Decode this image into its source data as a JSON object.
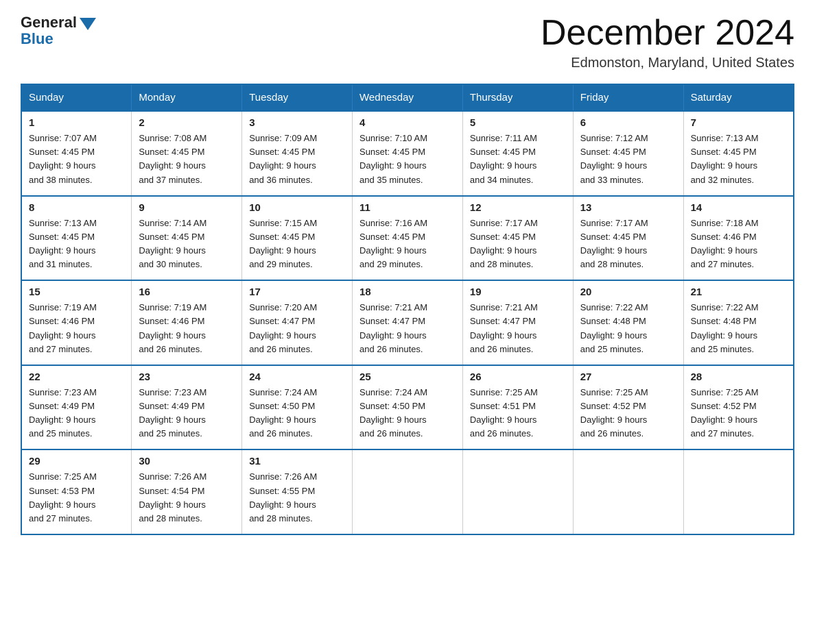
{
  "logo": {
    "general": "General",
    "blue": "Blue"
  },
  "title": "December 2024",
  "location": "Edmonston, Maryland, United States",
  "days_of_week": [
    "Sunday",
    "Monday",
    "Tuesday",
    "Wednesday",
    "Thursday",
    "Friday",
    "Saturday"
  ],
  "weeks": [
    [
      {
        "day": "1",
        "sunrise": "7:07 AM",
        "sunset": "4:45 PM",
        "daylight": "9 hours and 38 minutes."
      },
      {
        "day": "2",
        "sunrise": "7:08 AM",
        "sunset": "4:45 PM",
        "daylight": "9 hours and 37 minutes."
      },
      {
        "day": "3",
        "sunrise": "7:09 AM",
        "sunset": "4:45 PM",
        "daylight": "9 hours and 36 minutes."
      },
      {
        "day": "4",
        "sunrise": "7:10 AM",
        "sunset": "4:45 PM",
        "daylight": "9 hours and 35 minutes."
      },
      {
        "day": "5",
        "sunrise": "7:11 AM",
        "sunset": "4:45 PM",
        "daylight": "9 hours and 34 minutes."
      },
      {
        "day": "6",
        "sunrise": "7:12 AM",
        "sunset": "4:45 PM",
        "daylight": "9 hours and 33 minutes."
      },
      {
        "day": "7",
        "sunrise": "7:13 AM",
        "sunset": "4:45 PM",
        "daylight": "9 hours and 32 minutes."
      }
    ],
    [
      {
        "day": "8",
        "sunrise": "7:13 AM",
        "sunset": "4:45 PM",
        "daylight": "9 hours and 31 minutes."
      },
      {
        "day": "9",
        "sunrise": "7:14 AM",
        "sunset": "4:45 PM",
        "daylight": "9 hours and 30 minutes."
      },
      {
        "day": "10",
        "sunrise": "7:15 AM",
        "sunset": "4:45 PM",
        "daylight": "9 hours and 29 minutes."
      },
      {
        "day": "11",
        "sunrise": "7:16 AM",
        "sunset": "4:45 PM",
        "daylight": "9 hours and 29 minutes."
      },
      {
        "day": "12",
        "sunrise": "7:17 AM",
        "sunset": "4:45 PM",
        "daylight": "9 hours and 28 minutes."
      },
      {
        "day": "13",
        "sunrise": "7:17 AM",
        "sunset": "4:45 PM",
        "daylight": "9 hours and 28 minutes."
      },
      {
        "day": "14",
        "sunrise": "7:18 AM",
        "sunset": "4:46 PM",
        "daylight": "9 hours and 27 minutes."
      }
    ],
    [
      {
        "day": "15",
        "sunrise": "7:19 AM",
        "sunset": "4:46 PM",
        "daylight": "9 hours and 27 minutes."
      },
      {
        "day": "16",
        "sunrise": "7:19 AM",
        "sunset": "4:46 PM",
        "daylight": "9 hours and 26 minutes."
      },
      {
        "day": "17",
        "sunrise": "7:20 AM",
        "sunset": "4:47 PM",
        "daylight": "9 hours and 26 minutes."
      },
      {
        "day": "18",
        "sunrise": "7:21 AM",
        "sunset": "4:47 PM",
        "daylight": "9 hours and 26 minutes."
      },
      {
        "day": "19",
        "sunrise": "7:21 AM",
        "sunset": "4:47 PM",
        "daylight": "9 hours and 26 minutes."
      },
      {
        "day": "20",
        "sunrise": "7:22 AM",
        "sunset": "4:48 PM",
        "daylight": "9 hours and 25 minutes."
      },
      {
        "day": "21",
        "sunrise": "7:22 AM",
        "sunset": "4:48 PM",
        "daylight": "9 hours and 25 minutes."
      }
    ],
    [
      {
        "day": "22",
        "sunrise": "7:23 AM",
        "sunset": "4:49 PM",
        "daylight": "9 hours and 25 minutes."
      },
      {
        "day": "23",
        "sunrise": "7:23 AM",
        "sunset": "4:49 PM",
        "daylight": "9 hours and 25 minutes."
      },
      {
        "day": "24",
        "sunrise": "7:24 AM",
        "sunset": "4:50 PM",
        "daylight": "9 hours and 26 minutes."
      },
      {
        "day": "25",
        "sunrise": "7:24 AM",
        "sunset": "4:50 PM",
        "daylight": "9 hours and 26 minutes."
      },
      {
        "day": "26",
        "sunrise": "7:25 AM",
        "sunset": "4:51 PM",
        "daylight": "9 hours and 26 minutes."
      },
      {
        "day": "27",
        "sunrise": "7:25 AM",
        "sunset": "4:52 PM",
        "daylight": "9 hours and 26 minutes."
      },
      {
        "day": "28",
        "sunrise": "7:25 AM",
        "sunset": "4:52 PM",
        "daylight": "9 hours and 27 minutes."
      }
    ],
    [
      {
        "day": "29",
        "sunrise": "7:25 AM",
        "sunset": "4:53 PM",
        "daylight": "9 hours and 27 minutes."
      },
      {
        "day": "30",
        "sunrise": "7:26 AM",
        "sunset": "4:54 PM",
        "daylight": "9 hours and 28 minutes."
      },
      {
        "day": "31",
        "sunrise": "7:26 AM",
        "sunset": "4:55 PM",
        "daylight": "9 hours and 28 minutes."
      },
      null,
      null,
      null,
      null
    ]
  ],
  "labels": {
    "sunrise": "Sunrise:",
    "sunset": "Sunset:",
    "daylight": "Daylight:"
  },
  "colors": {
    "header_bg": "#1a6baa",
    "header_text": "#ffffff",
    "border": "#1a6baa"
  }
}
